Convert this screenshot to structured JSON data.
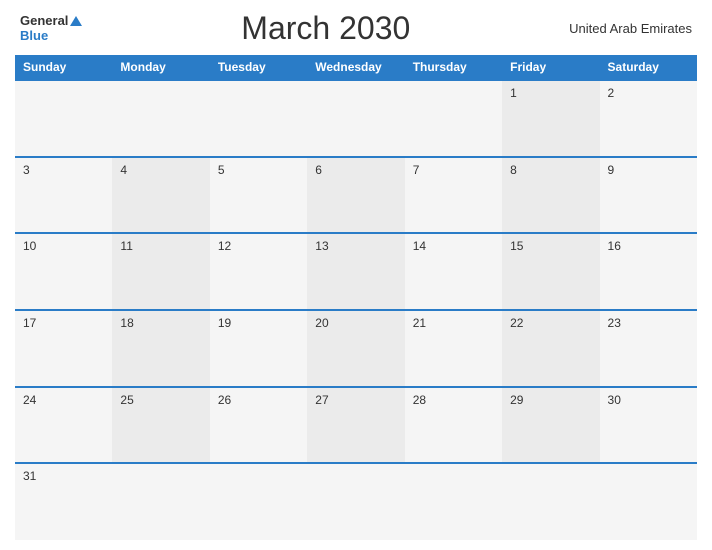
{
  "header": {
    "logo_general": "General",
    "logo_blue": "Blue",
    "title": "March 2030",
    "country": "United Arab Emirates"
  },
  "days_of_week": [
    "Sunday",
    "Monday",
    "Tuesday",
    "Wednesday",
    "Thursday",
    "Friday",
    "Saturday"
  ],
  "weeks": [
    [
      null,
      null,
      null,
      null,
      null,
      1,
      2
    ],
    [
      3,
      4,
      5,
      6,
      7,
      8,
      9
    ],
    [
      10,
      11,
      12,
      13,
      14,
      15,
      16
    ],
    [
      17,
      18,
      19,
      20,
      21,
      22,
      23
    ],
    [
      24,
      25,
      26,
      27,
      28,
      29,
      30
    ],
    [
      31,
      null,
      null,
      null,
      null,
      null,
      null
    ]
  ]
}
